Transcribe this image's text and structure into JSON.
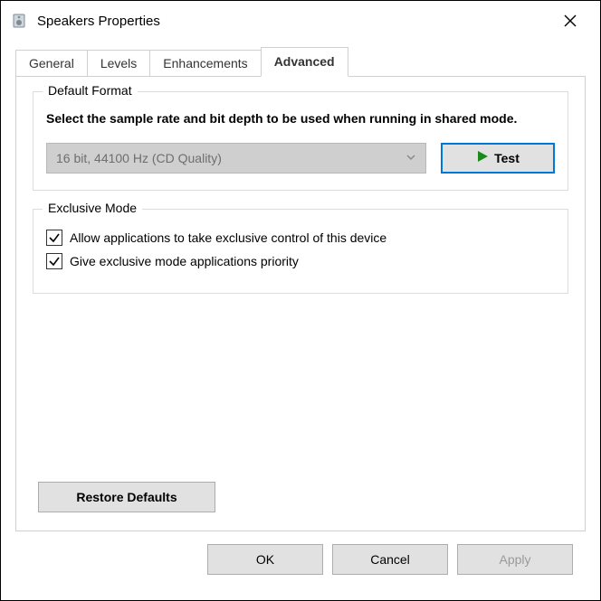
{
  "window": {
    "title": "Speakers Properties"
  },
  "tabs": [
    {
      "label": "General"
    },
    {
      "label": "Levels"
    },
    {
      "label": "Enhancements"
    },
    {
      "label": "Advanced"
    }
  ],
  "default_format": {
    "group_title": "Default Format",
    "description": "Select the sample rate and bit depth to be used when running in shared mode.",
    "selected": "16 bit, 44100 Hz (CD Quality)",
    "test_label": "Test"
  },
  "exclusive_mode": {
    "group_title": "Exclusive Mode",
    "opt_allow": "Allow applications to take exclusive control of this device",
    "opt_priority": "Give exclusive mode applications priority"
  },
  "buttons": {
    "restore": "Restore Defaults",
    "ok": "OK",
    "cancel": "Cancel",
    "apply": "Apply"
  }
}
